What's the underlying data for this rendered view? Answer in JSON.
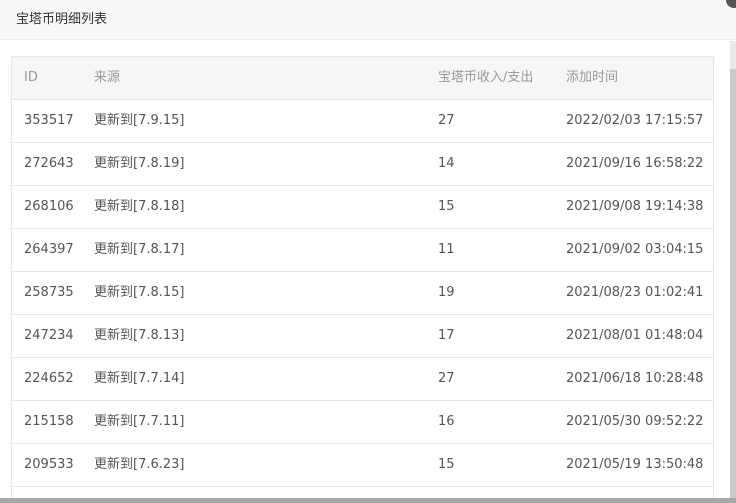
{
  "dialog": {
    "title": "宝塔币明细列表"
  },
  "table": {
    "headers": {
      "id": "ID",
      "source": "来源",
      "amount": "宝塔币收入/支出",
      "time": "添加时间"
    },
    "rows": [
      {
        "id": "353517",
        "source": "更新到[7.9.15]",
        "amount": "27",
        "time": "2022/02/03 17:15:57"
      },
      {
        "id": "272643",
        "source": "更新到[7.8.19]",
        "amount": "14",
        "time": "2021/09/16 16:58:22"
      },
      {
        "id": "268106",
        "source": "更新到[7.8.18]",
        "amount": "15",
        "time": "2021/09/08 19:14:38"
      },
      {
        "id": "264397",
        "source": "更新到[7.8.17]",
        "amount": "11",
        "time": "2021/09/02 03:04:15"
      },
      {
        "id": "258735",
        "source": "更新到[7.8.15]",
        "amount": "19",
        "time": "2021/08/23 01:02:41"
      },
      {
        "id": "247234",
        "source": "更新到[7.8.13]",
        "amount": "17",
        "time": "2021/08/01 01:48:04"
      },
      {
        "id": "224652",
        "source": "更新到[7.7.14]",
        "amount": "27",
        "time": "2021/06/18 10:28:48"
      },
      {
        "id": "215158",
        "source": "更新到[7.7.11]",
        "amount": "16",
        "time": "2021/05/30 09:52:22"
      },
      {
        "id": "209533",
        "source": "更新到[7.6.23]",
        "amount": "15",
        "time": "2021/05/19 13:50:48"
      }
    ]
  }
}
